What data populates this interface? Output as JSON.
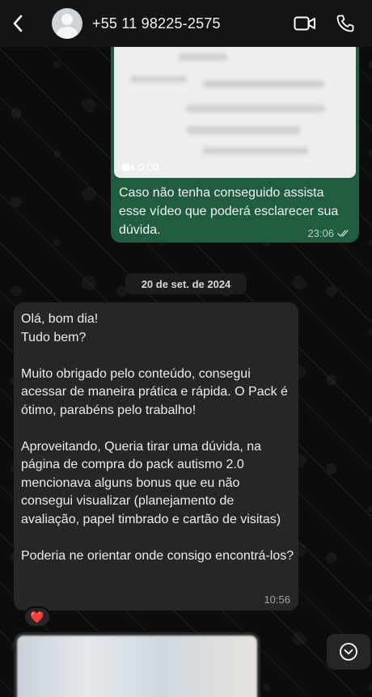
{
  "header": {
    "contact_name": "+55 11 98225-2575",
    "icons": [
      "back-chevron-icon",
      "avatar",
      "video-call-icon",
      "phone-icon"
    ]
  },
  "messages": {
    "outgoing": {
      "video_duration": "0:00",
      "caption": "Caso não tenha conseguido assista esse vídeo que poderá esclarecer sua dúvida.",
      "time": "23:06",
      "status_icon": "double-check-icon"
    },
    "date_separator": "20 de set. de 2024",
    "incoming": {
      "text": "Olá, bom dia!\nTudo bem?\n\nMuito obrigado pelo conteúdo, consegui acessar de maneira prática e rápida. O Pack é ótimo, parabéns pelo trabalho!\n\nAproveitando, Queria tirar uma dúvida, na página de compra do pack autismo 2.0 mencionava alguns bonus que eu não consegui visualizar (planejamento de avaliação, papel timbrado e cartão de visitas)\n\nPoderia ne orientar onde consigo encontrá-los?",
      "time": "10:56",
      "reaction": "❤️"
    }
  },
  "colors": {
    "header_bg": "#141414",
    "outgoing_bubble": "#1f5c40",
    "incoming_bubble": "#262626",
    "text": "#e9edef"
  }
}
